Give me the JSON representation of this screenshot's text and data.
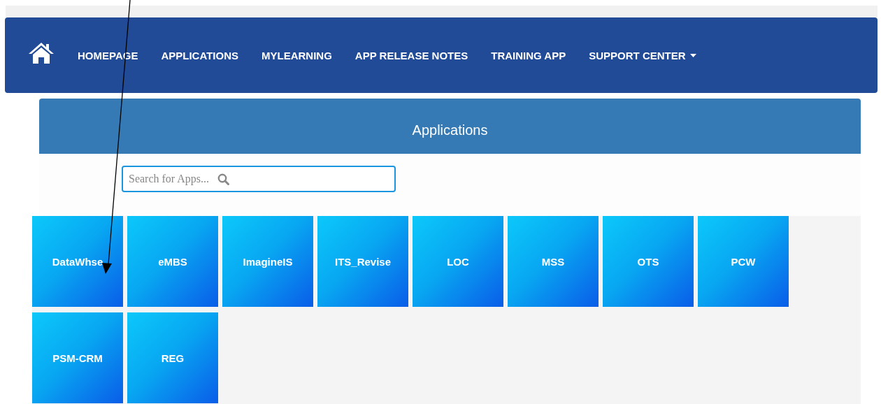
{
  "navbar": {
    "items": [
      {
        "label": "HOMEPAGE",
        "kind": "link"
      },
      {
        "label": "APPLICATIONS",
        "kind": "link"
      },
      {
        "label": "MYLEARNING",
        "kind": "link"
      },
      {
        "label": "APP RELEASE NOTES",
        "kind": "link"
      },
      {
        "label": "TRAINING APP",
        "kind": "link"
      },
      {
        "label": "SUPPORT CENTER",
        "kind": "dropdown"
      }
    ]
  },
  "panel": {
    "title": "Applications",
    "search": {
      "placeholder": "Search for Apps..."
    }
  },
  "apps": [
    {
      "label": "DataWhse"
    },
    {
      "label": "eMBS"
    },
    {
      "label": "ImagineIS"
    },
    {
      "label": "ITS_Revise"
    },
    {
      "label": "LOC"
    },
    {
      "label": "MSS"
    },
    {
      "label": "OTS"
    },
    {
      "label": "PCW"
    },
    {
      "label": "PSM-CRM"
    },
    {
      "label": "REG"
    }
  ]
}
